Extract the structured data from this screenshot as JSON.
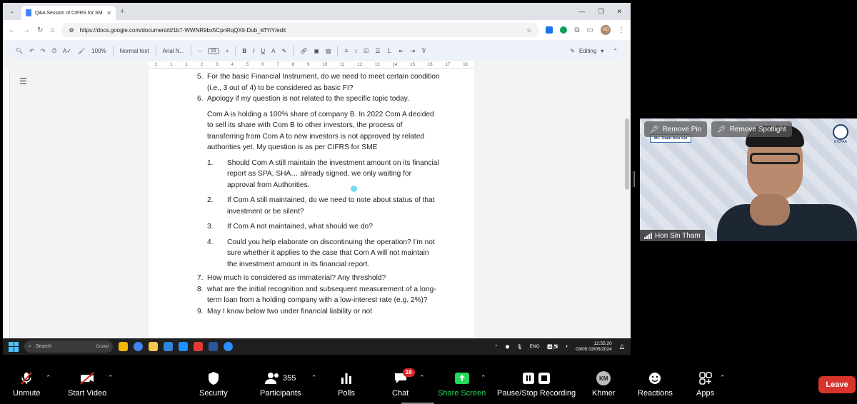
{
  "browser": {
    "tab_title": "Q&A Session of CIFRS for SME",
    "url": "https://docs.google.com/document/d/1b7-WWNR9bx5CpnRqQXtl-Dub_kffYiY/edit",
    "profile_initials": "HO"
  },
  "docs_toolbar": {
    "zoom": "100%",
    "style": "Normal text",
    "font": "Arial N...",
    "font_size": "16",
    "mode": "Editing"
  },
  "ruler_ticks": [
    "2",
    "1",
    "1",
    "2",
    "3",
    "4",
    "5",
    "6",
    "7",
    "8",
    "9",
    "10",
    "11",
    "12",
    "13",
    "14",
    "15",
    "16",
    "17",
    "18"
  ],
  "document": {
    "item5_num": "5.",
    "item5": "For the basic Financial Instrument, do we need to meet certain condition (i.e., 3 out of 4) to be considered as basic FI?",
    "item6_num": "6.",
    "item6": "Apology if my question is not related to the specific topic today.",
    "para": "Com A is holding a 100% share of company B. In 2022 Com A decided to sell its share with Com B to other investors, the process of transferring from Com A to new investors is not approved by related authorities yet. My question is as per CIFRS for SME",
    "sub": [
      {
        "n": "1.",
        "text": "Should Com A still maintain the investment amount on its financial report as SPA, SHA… already signed, we only waiting for approval from Authorities."
      },
      {
        "n": "2.",
        "text": "If Com A still maintained, do we need to note about status of that investment or be silent?"
      },
      {
        "n": "3.",
        "text": "If Com A not maintained, what should we do?"
      },
      {
        "n": "4.",
        "text": "Could you help elaborate on discontinuing the operation? I'm not sure whether it applies to the case that Com A will not maintain the investment amount in its financial report."
      }
    ],
    "item7_num": "7.",
    "item7": "How much is considered as immaterial? Any threshold?",
    "item8_num": "8.",
    "item8": "what are the initial recognition and subsequent measurement of a long-term loan from a holding company with a low-interest rate (e.g. 2%)?",
    "item9_num": "9.",
    "item9": "May I know below two under financial liability or not"
  },
  "taskbar": {
    "search_placeholder": "Search",
    "search_hint": "Crowd",
    "lang": "ENG",
    "time": "12:55:20",
    "date_left": "03/05",
    "date": "03/05/2024"
  },
  "video": {
    "remove_pin": "Remove Pin",
    "remove_spotlight": "Remove Spotlight",
    "namecard": "Mr. Tham Hon Sin",
    "logo_text": "KICPAA",
    "speaker": "Hon Sin Tham"
  },
  "zoombar": {
    "unmute": "Unmute",
    "start_video": "Start Video",
    "security": "Security",
    "participants": "Participants",
    "participants_count": "355",
    "polls": "Polls",
    "chat": "Chat",
    "chat_badge": "16",
    "share_screen": "Share Screen",
    "recording": "Pause/Stop Recording",
    "language_initials": "KM",
    "language": "Khmer",
    "reactions": "Reactions",
    "apps": "Apps",
    "leave": "Leave"
  },
  "colors": {
    "share_green": "#23d959",
    "leave_red": "#d9342b",
    "docs_blue": "#4285f4"
  }
}
